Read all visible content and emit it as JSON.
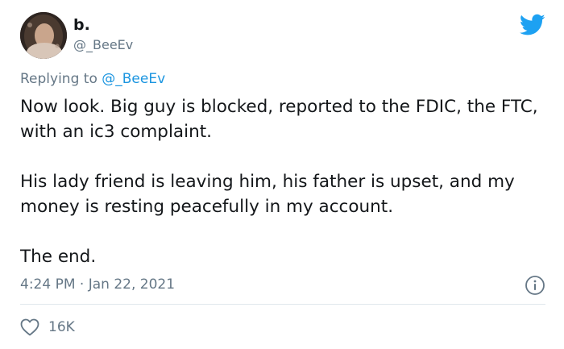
{
  "tweet": {
    "display_name": "b.",
    "handle": "@_BeeEv",
    "replying_prefix": "Replying to",
    "replying_to": "@_BeeEv",
    "paragraphs": [
      "Now look. Big guy is blocked, reported to the FDIC, the FTC, with an ic3 complaint.",
      "His lady friend is leaving him, his father is upset, and my money is resting peacefully in my account.",
      "The end."
    ],
    "time": "4:24 PM",
    "separator": "·",
    "date": "Jan 22, 2021",
    "likes": "16K"
  },
  "icons": {
    "logo": "twitter-bird-icon",
    "info": "info-icon",
    "like": "heart-icon"
  },
  "colors": {
    "brand": "#1da1f2",
    "link": "#1b95e0",
    "muted": "#657786",
    "text": "#14171a",
    "divider": "#e1e8ed"
  }
}
